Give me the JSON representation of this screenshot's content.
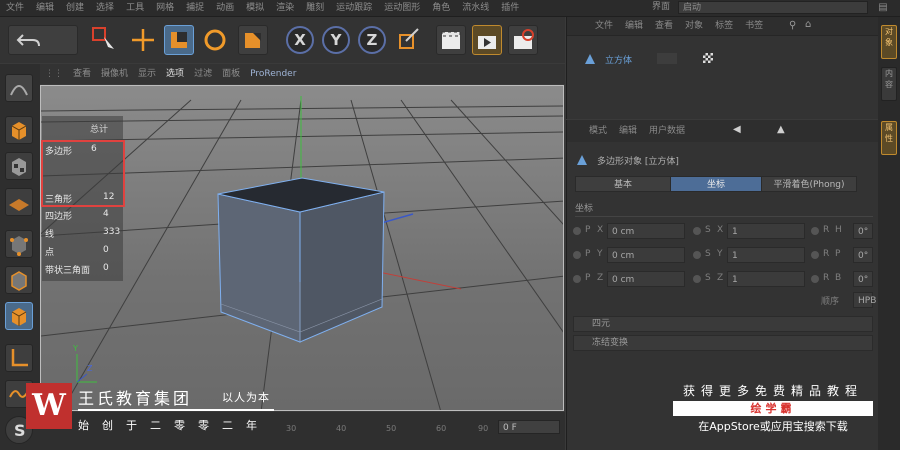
{
  "menu": {
    "items": [
      "文件",
      "编辑",
      "创建",
      "选择",
      "工具",
      "网格",
      "捕捉",
      "动画",
      "模拟",
      "渲染",
      "雕刻",
      "运动跟踪",
      "运动图形",
      "角色",
      "流水线",
      "插件",
      "脚本"
    ],
    "layout_label": "界面",
    "layout_value": "启动"
  },
  "viewport_menu": [
    "查看",
    "摄像机",
    "显示",
    "选项",
    "过滤",
    "面板",
    "ProRender"
  ],
  "toolbar": {
    "axis_x": "X",
    "axis_y": "Y",
    "axis_z": "Z"
  },
  "stats": {
    "header": "总计",
    "rows": [
      {
        "label": "多边形",
        "value": "6"
      },
      {
        "label": "三角形",
        "value": "12"
      },
      {
        "label": "四边形",
        "value": "4"
      },
      {
        "label": "线",
        "value": "333"
      },
      {
        "label": "点",
        "value": "0"
      },
      {
        "label": "带状三角面",
        "value": "0"
      }
    ]
  },
  "timeline": {
    "ticks": [
      "0",
      "10",
      "20",
      "30",
      "40",
      "50",
      "60",
      "70",
      "80",
      "90"
    ],
    "frame": "0 F"
  },
  "object_manager": {
    "menu": [
      "文件",
      "编辑",
      "查看",
      "对象",
      "标签",
      "书签"
    ],
    "object_name": "立方体"
  },
  "attributes": {
    "menu": [
      "模式",
      "编辑",
      "用户数据"
    ],
    "object_title": "多边形对象 [立方体]",
    "tabs": [
      "基本",
      "坐标",
      "平滑着色(Phong)"
    ],
    "section": "坐标",
    "rows": [
      {
        "axis": "P",
        "sub": "X",
        "pos": "0 cm",
        "saxis": "S",
        "ssub": "X",
        "scale": "1",
        "raxis": "R",
        "rsub": "H",
        "rot": "0°"
      },
      {
        "axis": "P",
        "sub": "Y",
        "pos": "0 cm",
        "saxis": "S",
        "ssub": "Y",
        "scale": "1",
        "raxis": "R",
        "rsub": "P",
        "rot": "0°"
      },
      {
        "axis": "P",
        "sub": "Z",
        "pos": "0 cm",
        "saxis": "S",
        "ssub": "Z",
        "scale": "1",
        "raxis": "R",
        "rsub": "B",
        "rot": "0°"
      }
    ],
    "order_label": "顺序",
    "order_value": "HPB",
    "collapsed": [
      "四元",
      "冻结变换"
    ]
  },
  "right_tabs": [
    "对象",
    "内容",
    "属性"
  ],
  "watermark_left": {
    "logo": "W",
    "name": "王氏教育集团",
    "slogan": "以人为本",
    "since": "始创于二零零二年"
  },
  "watermark_right": {
    "line1": "获得更多免费精品教程",
    "badge": "绘学霸",
    "line3": "在AppStore或应用宝搜索下载"
  },
  "colors": {
    "highlight": "#e0423f",
    "active_tab": "#4d6d97",
    "logo_red": "#c0302e"
  }
}
